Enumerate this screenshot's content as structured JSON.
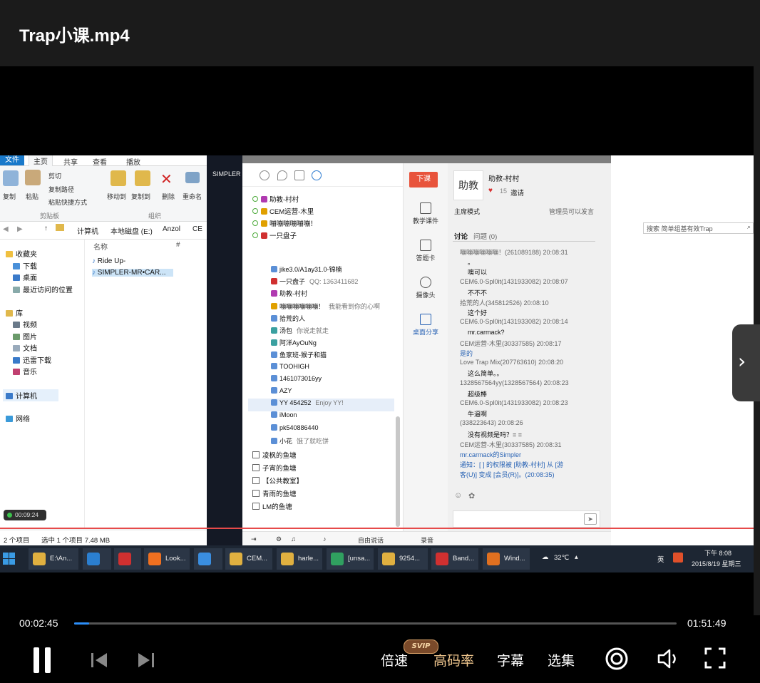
{
  "player": {
    "title": "Trap小课.mp4",
    "time_current": "00:02:45",
    "time_total": "01:51:49",
    "progress_fraction": 0.025,
    "controls": {
      "speed": "倍速",
      "hq": "高码率",
      "svip_badge": "SVIP",
      "subtitles": "字幕",
      "episodes": "选集"
    },
    "colors": {
      "progress": "#2c8ef8",
      "hq": "#f2c88f"
    }
  },
  "explorer": {
    "tabs": [
      "文件",
      "主页",
      "共享",
      "查看",
      "播放"
    ],
    "ribbon": {
      "copy": "复制",
      "paste": "粘贴",
      "cut": "剪切",
      "copy_path": "复制路径",
      "paste_shortcut": "粘贴快捷方式",
      "move_to": "移动到",
      "copy_to": "复制到",
      "delete": "删除",
      "rename": "重命名",
      "group_clipboard": "剪贴板",
      "group_organize": "组织"
    },
    "breadcrumb": [
      "计算机",
      "本地磁盘 (E:)",
      "Anzol",
      "CE"
    ],
    "search_placeholder": "搜索 简单组基有效Trap",
    "nav": {
      "favorites": "收藏夹",
      "downloads": "下载",
      "desktop": "桌面",
      "recent": "最近访问的位置",
      "libraries": "库",
      "videos": "视频",
      "pictures": "图片",
      "documents": "文档",
      "thunder": "迅雷下载",
      "music": "音乐",
      "computer": "计算机",
      "network": "网络"
    },
    "columns": {
      "name": "名称",
      "number": "#"
    },
    "files": [
      "Ride Up-",
      "SIMPLER-MR•CAR..."
    ],
    "status": {
      "count": "2 个项目",
      "selected": "选中 1 个项目 7.48 MB"
    },
    "recording_time": "00:09:24"
  },
  "mid_label": "SIMPLER",
  "yy": {
    "top_list": [
      {
        "name": "助教-村村",
        "color": "#b03ab0"
      },
      {
        "name": "CEM运营-木里",
        "color": "#e0a000"
      },
      {
        "name": "嘣嘣嘣嘣嘣嘣！",
        "color": "#e0a000"
      },
      {
        "name": "一只盘子",
        "color": "#d03030"
      }
    ],
    "members": [
      {
        "name": "jike3.0/A1ay31.0-锦楠",
        "sub": "",
        "color": "#5b8fd6"
      },
      {
        "name": "一只盘子",
        "sub": "QQ: 1363411682",
        "color": "#d03030"
      },
      {
        "name": "助教-村村",
        "sub": "",
        "color": "#b03ab0"
      },
      {
        "name": "嘣嘣嘣嘣嘣嘣！",
        "sub": "我能看到你的心啊",
        "color": "#e0a000"
      },
      {
        "name": "拾荒的人",
        "sub": "",
        "color": "#5b8fd6"
      },
      {
        "name": "汤包",
        "sub": "你说走就走",
        "color": "#3aa0a0"
      },
      {
        "name": "阿洋AyOuNg",
        "sub": "",
        "color": "#3aa0a0"
      },
      {
        "name": "鱼家班-猴子和猫",
        "sub": "",
        "color": "#5b8fd6"
      },
      {
        "name": "TOOHIGH",
        "sub": "",
        "color": "#5b8fd6"
      },
      {
        "name": "1461073016yy",
        "sub": "",
        "color": "#5b8fd6"
      },
      {
        "name": "AZY",
        "sub": "",
        "color": "#5b8fd6"
      },
      {
        "name": "YY 454252",
        "sub": "Enjoy YY!",
        "color": "#5b8fd6"
      },
      {
        "name": "iMoon",
        "sub": "",
        "color": "#5b8fd6"
      },
      {
        "name": "pk540886440",
        "sub": "",
        "color": "#5b8fd6"
      },
      {
        "name": "小花",
        "sub": "饿了就吃饼",
        "color": "#5b8fd6"
      }
    ],
    "channels": [
      "凌枫的鱼塘",
      "子宵的鱼塘",
      "【公共教室】",
      "青雨的鱼塘",
      "LM的鱼塘"
    ],
    "side": {
      "end_class": "下课",
      "courseware": "教学课件",
      "answer_card": "答题卡",
      "camera": "摄像头",
      "desktop_share": "桌面分享"
    },
    "host": {
      "name": "助教-村村",
      "likes": "15",
      "invite": "邀请",
      "avatar_text": "助教"
    },
    "mode": "主席模式",
    "mode_note": "管理员可以发言",
    "tabs": {
      "discuss": "讨论",
      "questions": "问题 (0)"
    },
    "chat": [
      {
        "type": "meta",
        "text": "嘣嘣嘣嘣嘣嘣！(261089188) 20:08:31"
      },
      {
        "type": "msg",
        "text": "。"
      },
      {
        "type": "msg",
        "text": "噢可以"
      },
      {
        "type": "meta",
        "text": "CEM6.0-Spl0it(1431933082) 20:08:07"
      },
      {
        "type": "msg",
        "text": "不不不"
      },
      {
        "type": "meta",
        "text": "拾荒的人(345812526) 20:08:10"
      },
      {
        "type": "msg",
        "text": "这个好"
      },
      {
        "type": "meta",
        "text": "CEM6.0-Spl0it(1431933082) 20:08:14"
      },
      {
        "type": "msg",
        "text": "mr.carmack?"
      },
      {
        "type": "meta",
        "text": "CEM运营-木里(30337585) 20:08:17"
      },
      {
        "type": "blue",
        "text": "是的"
      },
      {
        "type": "meta",
        "text": "Love Trap Mix(207763610) 20:08:20"
      },
      {
        "type": "msg",
        "text": "这么简单。。"
      },
      {
        "type": "meta",
        "text": "1328567564yy(1328567564) 20:08:23"
      },
      {
        "type": "msg",
        "text": "超级棒"
      },
      {
        "type": "meta",
        "text": "CEM6.0-Spl0it(1431933082) 20:08:23"
      },
      {
        "type": "msg",
        "text": "牛逼啊"
      },
      {
        "type": "meta",
        "text": "(338223643) 20:08:26"
      },
      {
        "type": "msg",
        "text": "没有视频是吗？= ="
      },
      {
        "type": "meta",
        "text": "CEM运营-木里(30337585) 20:08:31"
      },
      {
        "type": "blue",
        "text": "mr.carmack的Simpler"
      },
      {
        "type": "blue",
        "text": "通知：[ ] 的权限被 [助教-村村] 从 [游"
      },
      {
        "type": "blue",
        "text": "客(U)] 变成 [会员(R)]。(20:08:35)"
      }
    ],
    "bottom": {
      "free_talk": "自由说话",
      "record": "录音"
    }
  },
  "taskbar": {
    "items": [
      {
        "label": "E:\\An...",
        "color": "#e0b040"
      },
      {
        "label": "",
        "color": "#2b7fd0"
      },
      {
        "label": "",
        "color": "#d03030"
      },
      {
        "label": "Look...",
        "color": "#f07020"
      },
      {
        "label": "",
        "color": "#3a8ee0"
      },
      {
        "label": "CEM...",
        "color": "#e0b040"
      },
      {
        "label": "harle...",
        "color": "#e0b040"
      },
      {
        "label": "[unsa...",
        "color": "#30a060"
      },
      {
        "label": "9254...",
        "color": "#e0b040"
      },
      {
        "label": "Band...",
        "color": "#d03030"
      },
      {
        "label": "Wind...",
        "color": "#e07020"
      }
    ],
    "weather": "32℃",
    "ime": "英",
    "time": "下午 8:08",
    "date": "2015/8/19 星期三"
  }
}
